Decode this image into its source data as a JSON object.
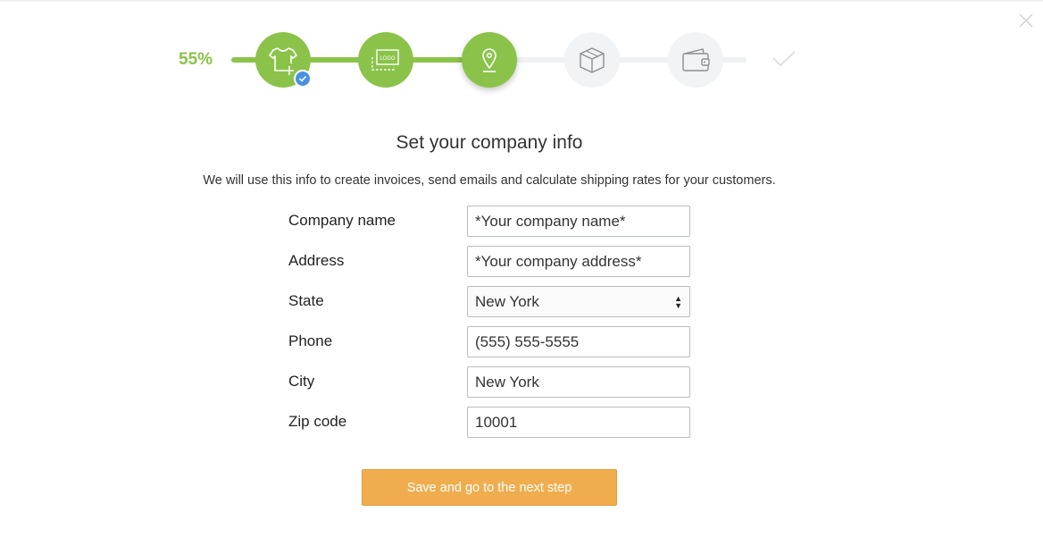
{
  "progress": {
    "percent_label": "55%",
    "percent_value": 55,
    "steps": [
      {
        "icon": "tshirt-add-icon",
        "state": "done"
      },
      {
        "icon": "logo-icon",
        "state": "done",
        "text": "LOGO"
      },
      {
        "icon": "location-pin-icon",
        "state": "active"
      },
      {
        "icon": "box-icon",
        "state": "todo"
      },
      {
        "icon": "wallet-icon",
        "state": "todo"
      },
      {
        "icon": "check-icon",
        "state": "todo"
      }
    ]
  },
  "colors": {
    "accent_green": "#8bc34a",
    "badge_blue": "#4a90e2",
    "button_orange": "#f0ad4e"
  },
  "heading": {
    "title": "Set your company info",
    "subtitle": "We will use this info to create invoices, send emails and calculate shipping rates for your customers."
  },
  "form": {
    "company_name": {
      "label": "Company name",
      "placeholder": "*Your company name*",
      "value": ""
    },
    "address": {
      "label": "Address",
      "placeholder": "*Your company address*",
      "value": ""
    },
    "state": {
      "label": "State",
      "value": "New York"
    },
    "phone": {
      "label": "Phone",
      "value": "(555) 555-5555"
    },
    "city": {
      "label": "City",
      "value": "New York"
    },
    "zip": {
      "label": "Zip code",
      "value": "10001"
    }
  },
  "submit_label": "Save and go to the next step"
}
